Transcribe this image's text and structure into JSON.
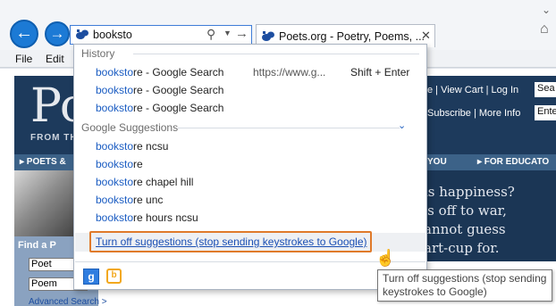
{
  "browser": {
    "address_text": "booksto",
    "tab_title": "Poets.org - Poetry, Poems, ...",
    "menu": [
      "File",
      "Edit"
    ],
    "icons": {
      "back": "back-arrow-icon",
      "forward": "forward-arrow-icon",
      "search": "search-icon",
      "dropdown": "chevron-down-icon",
      "go": "go-arrow-icon",
      "tab_close": "close-icon",
      "home": "home-icon"
    }
  },
  "page": {
    "logo": "Po",
    "logo_sub": "FROM TH",
    "header_links_1": "e | View Cart | Log In",
    "header_links_2": "Subscribe | More Info",
    "search_stub": "Sea",
    "enter_stub": "Ente",
    "nav_poets": "▸ POETS &",
    "nav_you": "YOU",
    "nav_educators": "▸ FOR EDUCATO",
    "quote": "is happiness?\n's off to war,\nannot guess\nart-cup for.",
    "find_title": "Find a P",
    "find_poet": "Poet",
    "find_poem": "Poem",
    "advanced_search": "Advanced Search >"
  },
  "dropdown": {
    "history_label": "History",
    "history": [
      {
        "typed": "booksto",
        "rest": "re - Google Search"
      },
      {
        "typed": "booksto",
        "rest": "re - Google Search"
      },
      {
        "typed": "booksto",
        "rest": "re - Google Search"
      }
    ],
    "history_url": "https://www.g...",
    "history_shortcut": "Shift + Enter",
    "google_label": "Google Suggestions",
    "suggestions": [
      {
        "typed": "booksto",
        "rest": "re ncsu"
      },
      {
        "typed": "booksto",
        "rest": "re"
      },
      {
        "typed": "booksto",
        "rest": "re chapel hill"
      },
      {
        "typed": "booksto",
        "rest": "re unc"
      },
      {
        "typed": "booksto",
        "rest": "re hours ncsu"
      }
    ],
    "turn_off_link": "Turn off suggestions (stop sending keystrokes to Google)",
    "highlight_color": "#e07a2a",
    "providers": [
      "google-icon",
      "bing-icon"
    ]
  },
  "tooltip": {
    "line1": "Turn off suggestions (stop sending",
    "line2": "keystrokes to Google)"
  }
}
